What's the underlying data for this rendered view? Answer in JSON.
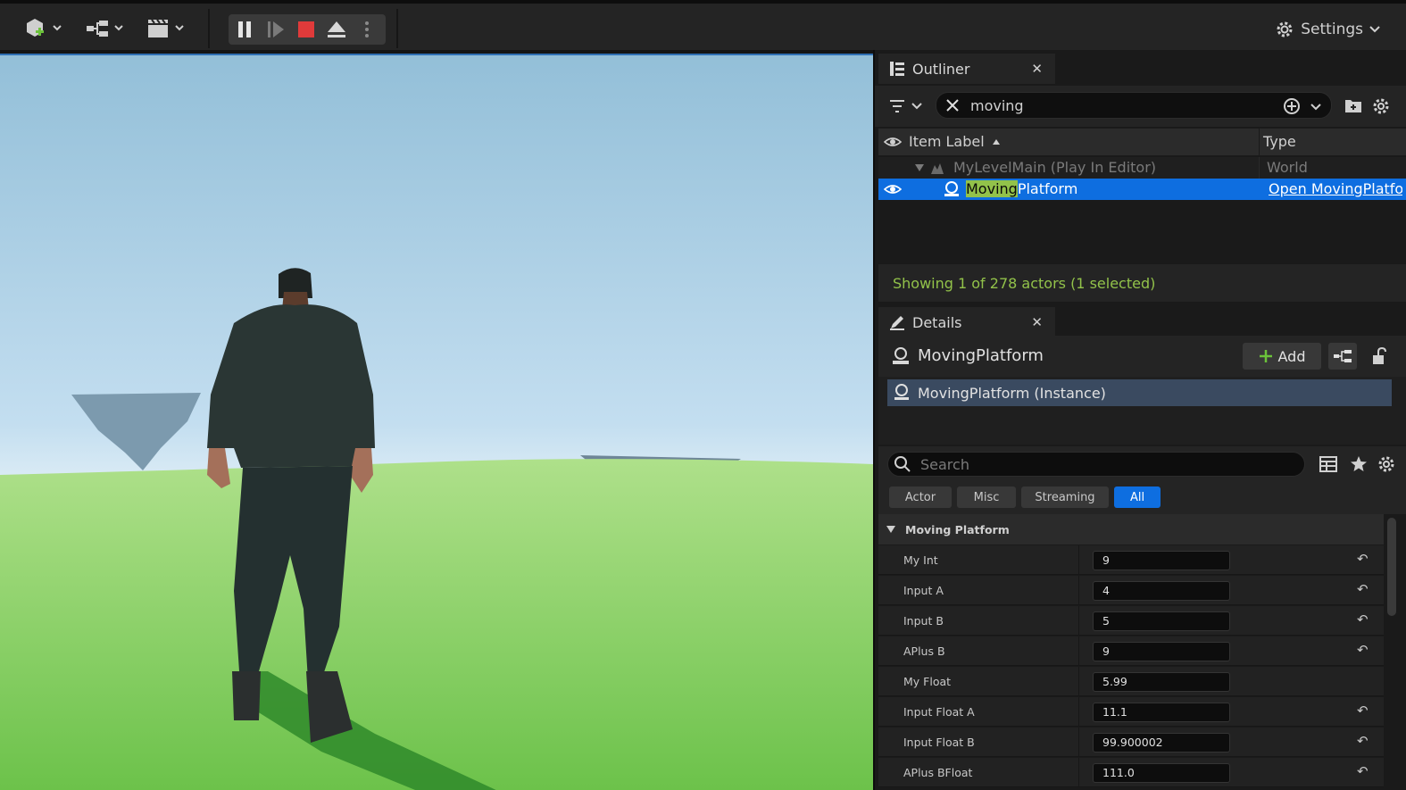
{
  "toolbar": {
    "settings_label": "Settings"
  },
  "outliner": {
    "tab_label": "Outliner",
    "search_value": "moving",
    "col_label": "Item Label",
    "col_type": "Type",
    "rows": [
      {
        "label": "MyLevelMain (Play In Editor)",
        "type": "World"
      },
      {
        "label_match": "Moving",
        "label_rest": "Platform",
        "type": "Open MovingPlatfo"
      }
    ],
    "status": "Showing 1 of 278 actors (1 selected)"
  },
  "details": {
    "tab_label": "Details",
    "actor_name": "MovingPlatform",
    "add_label": "Add",
    "component_label": "MovingPlatform (Instance)",
    "search_placeholder": "Search",
    "filters": [
      "Actor",
      "Misc",
      "Streaming",
      "All"
    ],
    "category": "Moving Platform",
    "properties": [
      {
        "label": "My Int",
        "value": "9"
      },
      {
        "label": "Input A",
        "value": "4"
      },
      {
        "label": "Input B",
        "value": "5"
      },
      {
        "label": "APlus B",
        "value": "9"
      },
      {
        "label": "My Float",
        "value": "5.99"
      },
      {
        "label": "Input Float A",
        "value": "11.1"
      },
      {
        "label": "Input Float B",
        "value": "99.900002"
      },
      {
        "label": "APlus BFloat",
        "value": "111.0"
      }
    ]
  },
  "colors": {
    "selection": "#0e6ee0",
    "highlight": "#92c24a",
    "stop": "#e03a3a"
  }
}
